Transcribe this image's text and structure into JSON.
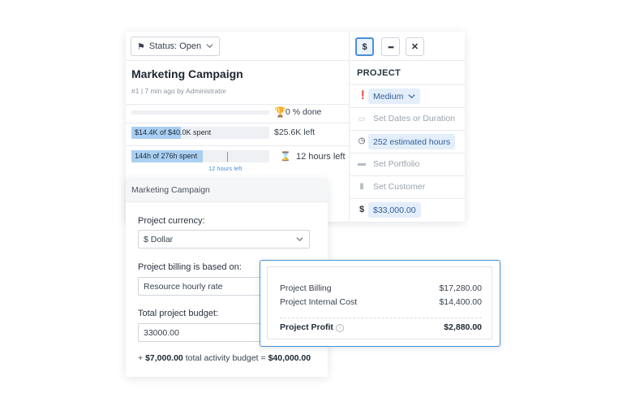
{
  "status": {
    "label": "Status: Open"
  },
  "project": {
    "title": "Marketing Campaign",
    "meta": "#1 | 7 min ago by Administrator",
    "progress": {
      "fraction": 0.0,
      "label": "0 % done"
    },
    "budget": {
      "fraction": 0.36,
      "label": "$14.4K of $40.0K spent",
      "left": "$25.6K left"
    },
    "hours": {
      "fraction": 0.52,
      "label": "144h of 276h spent",
      "left": "12 hours left",
      "marker_label": "12 hours left"
    }
  },
  "toolbar": {
    "dollar_label": "$",
    "more_label": "•••",
    "close_label": "✕"
  },
  "properties": {
    "header": "PROJECT",
    "priority": "Medium",
    "dates": "Set Dates or Duration",
    "estimate": "252 estimated hours",
    "portfolio": "Set Portfolio",
    "customer": "Set Customer",
    "budget": "$33,000.00"
  },
  "budget_panel": {
    "header": "Marketing Campaign",
    "currency_label": "Project currency:",
    "currency_value": "$ Dollar",
    "billing_label": "Project billing is based on:",
    "billing_value": "Resource hourly rate",
    "total_label": "Total project budget:",
    "total_value": "33000.00",
    "footer_prefix": "+ ",
    "footer_activity": "$7,000.00",
    "footer_mid": " total activity budget = ",
    "footer_total": "$40,000.00"
  },
  "profit": {
    "billing_label": "Project Billing",
    "billing_value": "$17,280.00",
    "cost_label": "Project Internal Cost",
    "cost_value": "$14,400.00",
    "profit_label": "Project Profit",
    "profit_value": "$2,880.00"
  },
  "colors": {
    "accent": "#4a90d9",
    "bar_fill": "#a9cff2",
    "pill_bg": "#e4eefb"
  }
}
